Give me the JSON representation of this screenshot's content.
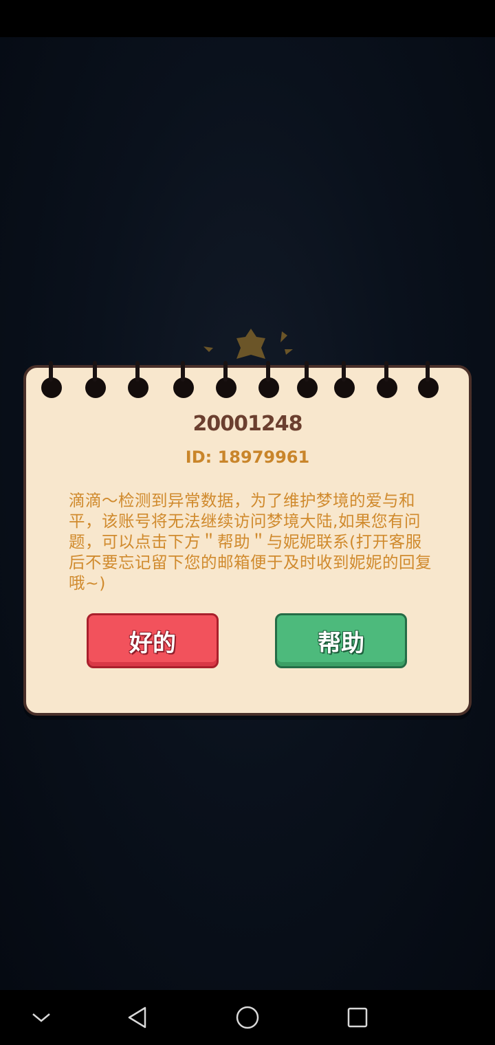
{
  "dialog": {
    "title": "20001248",
    "id_line": "ID: 18979961",
    "message": "滴滴～检测到异常数据，为了维护梦境的爱与和平，该账号将无法继续访问梦境大陆,如果您有问题，可以点击下方＂帮助＂与妮妮联系(打开客服后不要忘记留下您的邮箱便于及时收到妮妮的回复哦~)",
    "ok_label": "好的",
    "help_label": "帮助"
  },
  "nav_bar": {
    "icons": [
      "chevron-down-icon",
      "back-triangle-icon",
      "home-circle-icon",
      "recents-square-icon"
    ]
  },
  "colors": {
    "ok_button": "#f2525c",
    "help_button": "#4dba7c",
    "dialog_bg": "#f8e7cd",
    "message_text": "#d08a2d"
  }
}
